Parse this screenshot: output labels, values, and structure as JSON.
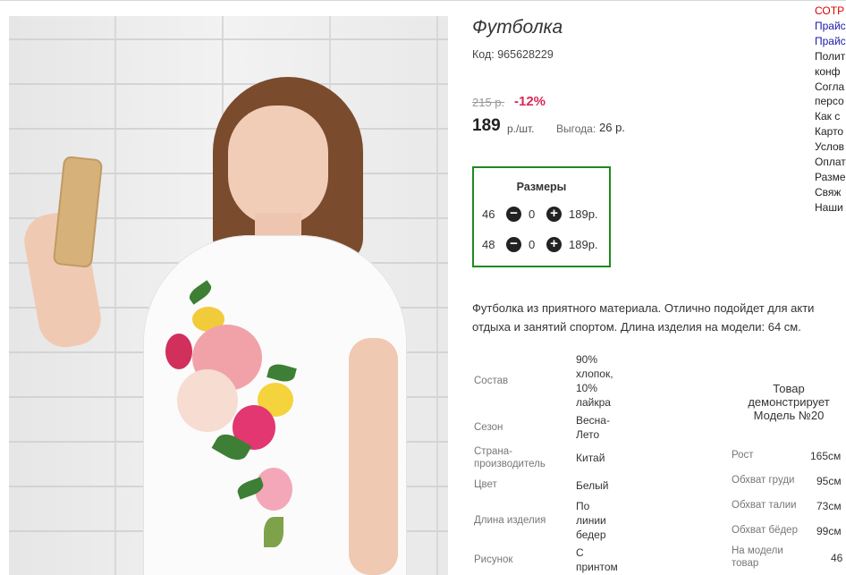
{
  "product": {
    "title": "Футболка",
    "code_label": "Код:",
    "code": "965628229",
    "old_price": "215 р.",
    "discount": "-12%",
    "price": "189",
    "unit": "р./шт.",
    "saving_label": "Выгода:",
    "saving_value": "26 р."
  },
  "sizes": {
    "title": "Размеры",
    "rows": [
      {
        "size": "46",
        "qty": "0",
        "price": "189р."
      },
      {
        "size": "48",
        "qty": "0",
        "price": "189р."
      }
    ],
    "minus_icon": "−",
    "plus_icon": "+"
  },
  "description": {
    "line1": "Футболка из приятного материала. Отлично подойдет для акти",
    "line2": "отдыха и занятий спортом. Длина изделия на модели: 64 см."
  },
  "specs": {
    "composition_label": "Состав",
    "composition_value": [
      "90%",
      "хлопок,",
      "10%",
      "лайкра"
    ],
    "season_label": "Сезон",
    "season_value": [
      "Весна-",
      "Лето"
    ],
    "country_label": [
      "Страна-",
      "производитель"
    ],
    "country_value": "Китай",
    "color_label": "Цвет",
    "color_value": "Белый",
    "length_label": "Длина изделия",
    "length_value": [
      "По",
      "линии",
      "бедер"
    ],
    "pattern_label": "Рисунок",
    "pattern_value": [
      "С",
      "принтом"
    ]
  },
  "model": {
    "demo": [
      "Товар",
      "демонстрирует",
      "Модель №20"
    ],
    "height_label": "Рост",
    "height_value": "165см",
    "chest_label": "Обхват груди",
    "chest_value": "95см",
    "waist_label": "Обхват талии",
    "waist_value": "73см",
    "hips_label": "Обхват бёдер",
    "hips_value": "99см",
    "on_model_label": [
      "На модели",
      "товар"
    ],
    "on_model_value": "46"
  },
  "right_links": [
    {
      "text": "СОТР",
      "style": "red"
    },
    {
      "text": "Прайс",
      "style": "blue"
    },
    {
      "text": "Прайс",
      "style": "blue"
    },
    {
      "text": "Полит",
      "style": "plain"
    },
    {
      "text": "конф",
      "style": "plain"
    },
    {
      "text": "Согла",
      "style": "plain"
    },
    {
      "text": "персо",
      "style": "plain"
    },
    {
      "text": "Как с",
      "style": "plain"
    },
    {
      "text": "Карто",
      "style": "plain"
    },
    {
      "text": "Услов",
      "style": "plain"
    },
    {
      "text": "Оплат",
      "style": "plain"
    },
    {
      "text": "Разме",
      "style": "plain"
    },
    {
      "text": "Свяж",
      "style": "plain"
    },
    {
      "text": "Наши",
      "style": "plain"
    }
  ],
  "colors": {
    "discount": "#d72b56",
    "sizes_border": "#1e8a1e",
    "link_red": "#dd0000",
    "link_blue": "#1a1aa6"
  }
}
